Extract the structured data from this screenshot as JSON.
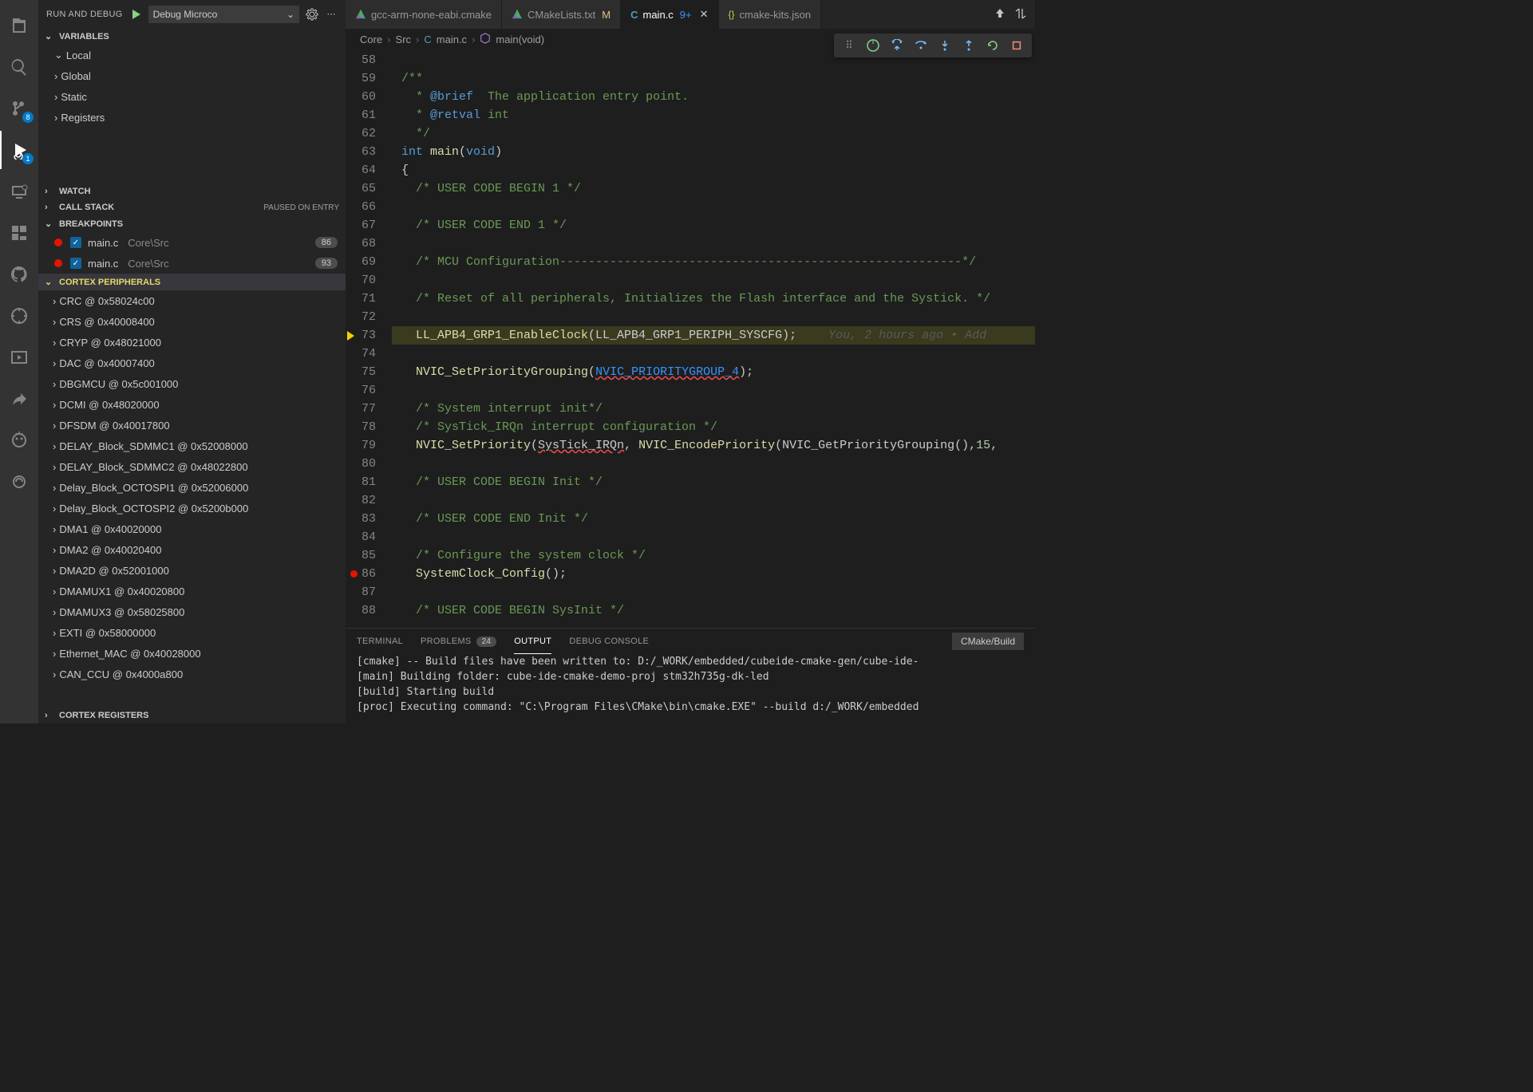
{
  "activity": {
    "scm_badge": "8",
    "debug_badge": "1"
  },
  "sidebar": {
    "title": "RUN AND DEBUG",
    "config": "Debug Microco",
    "sections": {
      "variables": "VARIABLES",
      "local": "Local",
      "global": "Global",
      "static": "Static",
      "registers": "Registers",
      "watch": "WATCH",
      "callstack": "CALL STACK",
      "callstack_status": "PAUSED ON ENTRY",
      "breakpoints": "BREAKPOINTS",
      "cortex_peripherals": "CORTEX PERIPHERALS",
      "cortex_registers": "CORTEX REGISTERS"
    },
    "breakpoints": [
      {
        "file": "main.c",
        "path": "Core\\Src",
        "line": "86"
      },
      {
        "file": "main.c",
        "path": "Core\\Src",
        "line": "93"
      }
    ],
    "peripherals": [
      "CRC @ 0x58024c00",
      "CRS @ 0x40008400",
      "CRYP @ 0x48021000",
      "DAC @ 0x40007400",
      "DBGMCU @ 0x5c001000",
      "DCMI @ 0x48020000",
      "DFSDM @ 0x40017800",
      "DELAY_Block_SDMMC1 @ 0x52008000",
      "DELAY_Block_SDMMC2 @ 0x48022800",
      "Delay_Block_OCTOSPI1 @ 0x52006000",
      "Delay_Block_OCTOSPI2 @ 0x5200b000",
      "DMA1 @ 0x40020000",
      "DMA2 @ 0x40020400",
      "DMA2D @ 0x52001000",
      "DMAMUX1 @ 0x40020800",
      "DMAMUX3 @ 0x58025800",
      "EXTI @ 0x58000000",
      "Ethernet_MAC @ 0x40028000",
      "CAN_CCU @ 0x4000a800"
    ]
  },
  "tabs": [
    {
      "icon": "cmake",
      "label": "gcc-arm-none-eabi.cmake",
      "modified": "",
      "active": false
    },
    {
      "icon": "cmake",
      "label": "CMakeLists.txt",
      "modified": "M",
      "active": false
    },
    {
      "icon": "c",
      "label": "main.c",
      "modified": "9+",
      "active": true
    },
    {
      "icon": "json",
      "label": "cmake-kits.json",
      "modified": "",
      "active": false
    }
  ],
  "breadcrumb": {
    "a": "Core",
    "b": "Src",
    "c": "main.c",
    "d": "main(void)"
  },
  "code": {
    "start": 58,
    "current": 73,
    "bp": 86,
    "gitlens": "You, 2 hours ago • Add",
    "lines": {
      "l58": "",
      "l59": "/**",
      "l60_a": "  * ",
      "l60_b": "@brief",
      "l60_c": "  The application entry point.",
      "l61_a": "  * ",
      "l61_b": "@retval",
      "l61_c": " int",
      "l62": "  */",
      "l63_int": "int",
      "l63_main": " main",
      "l63_paren": "(",
      "l63_void": "void",
      "l63_close": ")",
      "l64": "{",
      "l65": "  /* USER CODE BEGIN 1 */",
      "l67": "  /* USER CODE END 1 */",
      "l69": "  /* MCU Configuration--------------------------------------------------------*/",
      "l71": "  /* Reset of all peripherals, Initializes the Flash interface and the Systick. */",
      "l73_fn": "  LL_APB4_GRP1_EnableClock",
      "l73_arg": "(LL_APB4_GRP1_PERIPH_SYSCFG);",
      "l75_fn": "  NVIC_SetPriorityGrouping",
      "l75_open": "(",
      "l75_arg": "NVIC_PRIORITYGROUP_4",
      "l75_close": ");",
      "l77": "  /* System interrupt init*/",
      "l78": "  /* SysTick_IRQn interrupt configuration */",
      "l79_a": "  NVIC_SetPriority",
      "l79_b": "(",
      "l79_c": "SysTick_IRQn",
      "l79_d": ", ",
      "l79_e": "NVIC_EncodePriority",
      "l79_f": "(NVIC_GetPriorityGrouping(),",
      "l79_g": "15",
      "l79_h": ",",
      "l81": "  /* USER CODE BEGIN Init */",
      "l83": "  /* USER CODE END Init */",
      "l85": "  /* Configure the system clock */",
      "l86_fn": "  SystemClock_Config",
      "l86_b": "();",
      "l88": "  /* USER CODE BEGIN SysInit */"
    }
  },
  "panel": {
    "tabs": {
      "terminal": "TERMINAL",
      "problems": "PROBLEMS",
      "problems_count": "24",
      "output": "OUTPUT",
      "debug": "DEBUG CONSOLE"
    },
    "select": "CMake/Build",
    "lines": [
      "[cmake] -- Build files have been written to: D:/_WORK/embedded/cubeide-cmake-gen/cube-ide-",
      "[main] Building folder: cube-ide-cmake-demo-proj stm32h735g-dk-led",
      "[build] Starting build",
      "[proc] Executing command: \"C:\\Program Files\\CMake\\bin\\cmake.EXE\" --build d:/_WORK/embedded"
    ]
  }
}
